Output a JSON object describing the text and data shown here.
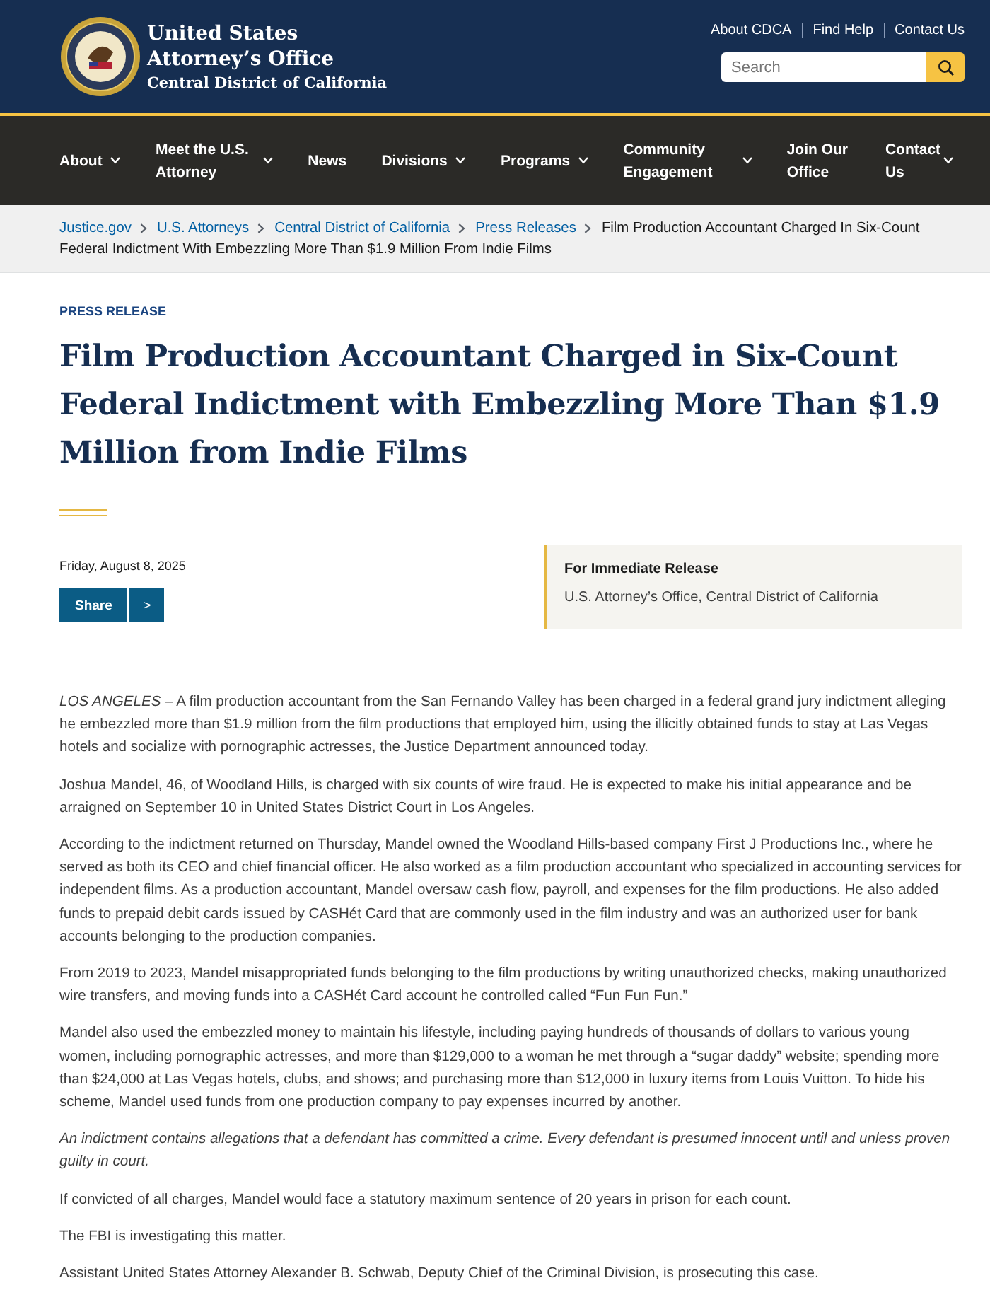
{
  "header": {
    "title_lines": [
      "United States",
      "Attorney’s Office"
    ],
    "subtitle": "Central District of California",
    "utility_links": [
      "About CDCA",
      "Find Help",
      "Contact Us"
    ],
    "search": {
      "placeholder": "Search"
    }
  },
  "nav": [
    {
      "label": "About",
      "dropdown": true
    },
    {
      "label": "Meet the U.S. Attorney",
      "dropdown": true
    },
    {
      "label": "News",
      "dropdown": false
    },
    {
      "label": "Divisions",
      "dropdown": true
    },
    {
      "label": "Programs",
      "dropdown": true
    },
    {
      "label": "Community Engagement",
      "dropdown": true
    },
    {
      "label": "Join Our Office",
      "dropdown": false
    },
    {
      "label": "Contact Us",
      "dropdown": true
    }
  ],
  "breadcrumb": {
    "links": [
      "Justice.gov",
      "U.S. Attorneys",
      "Central District of California",
      "Press Releases"
    ],
    "current_lines": [
      "Film Production Accountant Charged In Six-Count",
      "Federal Indictment With Embezzling More Than $1.9 Million From Indie Films"
    ]
  },
  "article": {
    "eyebrow": "PRESS RELEASE",
    "title": "Film Production Accountant Charged in Six-Count Federal Indictment with Embezzling More Than $1.9 Million from Indie Films",
    "date": "Friday, August 8, 2025",
    "share": "Share",
    "share_icon": ">",
    "release_box": {
      "heading": "For Immediate Release",
      "text": "U.S. Attorney’s Office, Central District of California"
    },
    "paragraphs": [
      {
        "kind": "body",
        "text": "*LOS ANGELES* – A film production accountant from the San Fernando Valley has been charged in a federal grand jury indictment alleging he embezzled more than $1.9 million from the film productions that employed him, using the illicitly obtained funds to stay at Las Vegas hotels and socialize with pornographic actresses, the Justice Department announced today."
      },
      {
        "kind": "body",
        "text": "Joshua Mandel, 46, of Woodland Hills, is charged with six counts of wire fraud. He is expected to make his initial appearance and be arraigned on September 10 in United States District Court in Los Angeles."
      },
      {
        "kind": "body",
        "text": "According to the indictment returned on Thursday, Mandel owned the Woodland Hills-based company First J Productions Inc., where he served as both its CEO and chief financial officer. He also worked as a film production accountant who specialized in accounting services for independent films. As a production accountant, Mandel oversaw cash flow, payroll, and expenses for the film productions. He also added funds to prepaid debit cards issued by CASHét Card that are commonly used in the film industry and was an authorized user for bank accounts belonging to the production companies."
      },
      {
        "kind": "body",
        "text": "From 2019 to 2023, Mandel misappropriated funds belonging to the film productions by writing unauthorized checks, making unauthorized wire transfers, and moving funds into a CASHét Card account he controlled called “Fun Fun Fun.”"
      },
      {
        "kind": "body",
        "text": "Mandel also used the embezzled money to maintain his lifestyle, including paying hundreds of thousands of dollars to various young women, including pornographic actresses, and more than $129,000 to a woman he met through a “sugar daddy” website; spending more than $24,000 at Las Vegas hotels, clubs, and shows; and purchasing more than $12,000 in luxury items from Louis Vuitton. To hide his scheme, Mandel used funds from one production company to pay expenses incurred by another."
      },
      {
        "kind": "note",
        "text": "An indictment contains allegations that a defendant has committed a crime. Every defendant is presumed innocent until and unless proven guilty in court."
      },
      {
        "kind": "body",
        "text": "If convicted of all charges, Mandel would face a statutory maximum sentence of 20 years in prison for each count."
      },
      {
        "kind": "body",
        "text": "The FBI is investigating this matter."
      },
      {
        "kind": "body",
        "text": "Assistant United States Attorney Alexander B. Schwab, Deputy Chief of the Criminal Division, is prosecuting this case."
      }
    ]
  }
}
